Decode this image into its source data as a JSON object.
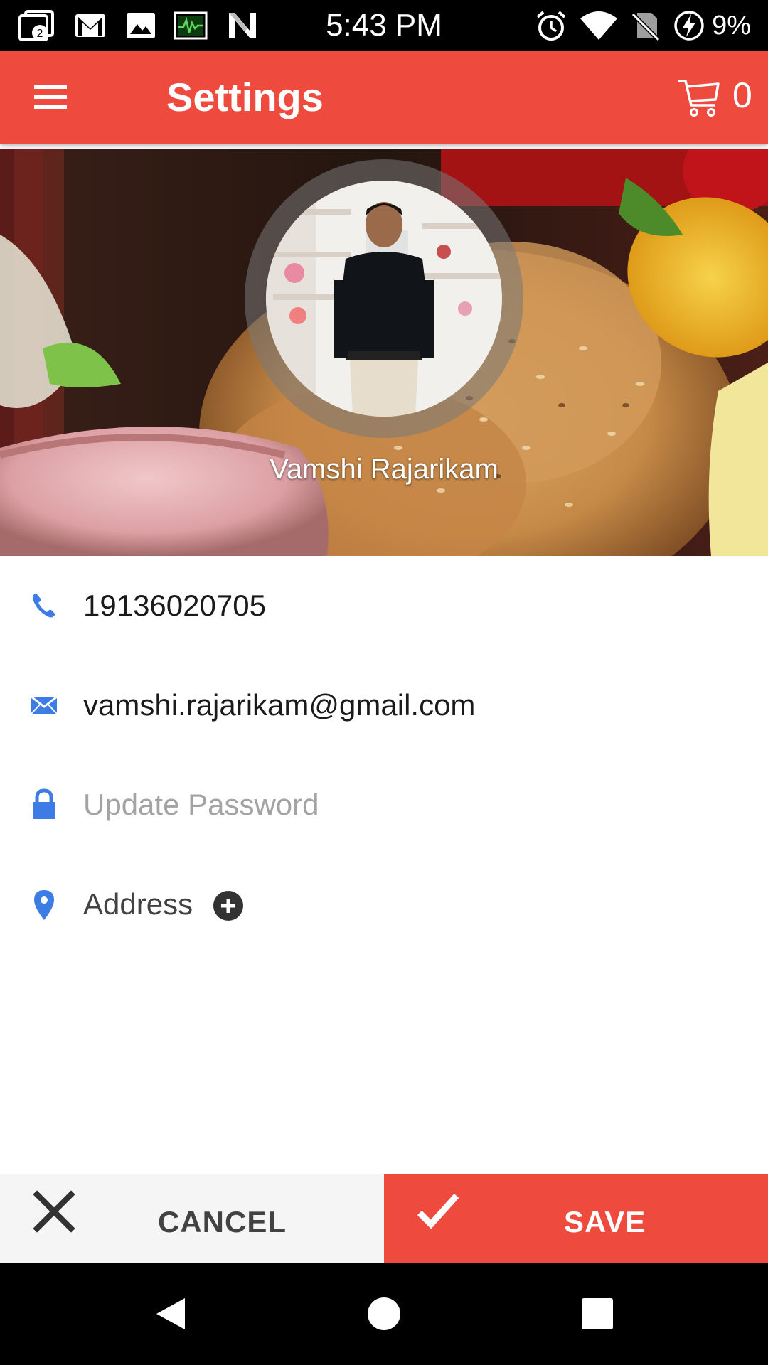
{
  "status_bar": {
    "time": "5:43 PM",
    "battery": "9%",
    "notification_badge": "2",
    "icons": [
      "notification-stack-icon",
      "gmail-icon",
      "image-icon",
      "activity-monitor-icon",
      "n-app-icon",
      "alarm-icon",
      "wifi-icon",
      "no-sim-icon",
      "battery-charging-icon"
    ]
  },
  "app_bar": {
    "menu_icon": "hamburger-menu-icon",
    "title": "Settings",
    "cart_icon": "cart-icon",
    "cart_count": "0"
  },
  "profile": {
    "name": "Vamshi Rajarikam"
  },
  "fields": {
    "phone": {
      "icon": "phone-icon",
      "value": "19136020705"
    },
    "email": {
      "icon": "mail-icon",
      "value": "vamshi.rajarikam@gmail.com"
    },
    "password": {
      "icon": "lock-icon",
      "placeholder": "Update Password"
    },
    "address": {
      "icon": "location-pin-icon",
      "label": "Address",
      "add_icon": "add-circle-icon"
    }
  },
  "actions": {
    "cancel_label": "CANCEL",
    "save_label": "SAVE"
  },
  "nav": {
    "icons": [
      "back-icon",
      "home-icon",
      "recents-icon"
    ]
  },
  "colors": {
    "primary": "#ee4a3e",
    "icon_accent": "#3d7ce4",
    "text_dark": "#1a1a1a",
    "placeholder": "#a3a3a3",
    "cancel_bg": "#f5f5f5"
  }
}
